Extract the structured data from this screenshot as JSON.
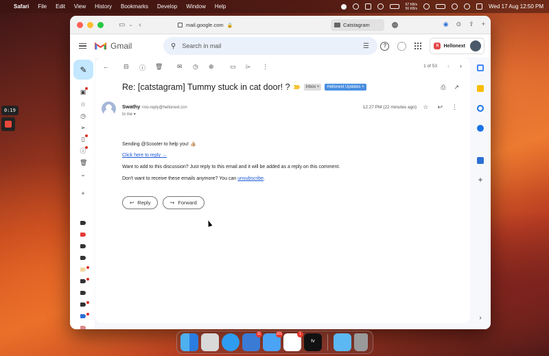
{
  "menubar": {
    "apple": "",
    "app": "Safari",
    "items": [
      "File",
      "Edit",
      "View",
      "History",
      "Bookmarks",
      "Develop",
      "Window",
      "Help"
    ],
    "net_up": "67 KB/s",
    "net_down": "56 KB/s",
    "datetime": "Wed 17 Aug  12:50 PM"
  },
  "recorder": {
    "time": "0:19"
  },
  "browser": {
    "url": "mail.google.com",
    "other_tab": "Catstagram"
  },
  "gmail": {
    "wordmark": "Gmail",
    "search_placeholder": "Search in mail",
    "account_badge": "Hellonext"
  },
  "toolbar": {
    "pager": "1 of 53"
  },
  "message": {
    "subject": "Re: [catstagram] Tummy stuck in cat door! ?",
    "labels": [
      "Inbox ×",
      "Hellonext Updates ×"
    ],
    "sender_name": "Swathy",
    "sender_addr": "<no-reply@hellonext.co>",
    "to": "to me",
    "time": "12:27 PM (22 minutes ago)",
    "line1": "Sending @Scooter to help you! 👍🏼",
    "reply_link": "Click here to reply →",
    "line2": "Want to add to this discussion? Just reply to this email and it will be added as a reply on this comment.",
    "line3_prefix": "Don't want to receive these emails anymore? You can",
    "unsubscribe": "unsubscribe",
    "line3_suffix": "."
  },
  "actions": {
    "reply": "Reply",
    "forward": "Forward"
  },
  "dock": {
    "calendar_badge": "11",
    "mail_badge": "101",
    "slack_badge": "1",
    "tv_label": "tv"
  },
  "colors": {
    "compose_bg": "#c2e7ff",
    "label_blue": "#4a8fe0",
    "link_blue": "#1a57d6",
    "badge_red": "#e8382e"
  }
}
